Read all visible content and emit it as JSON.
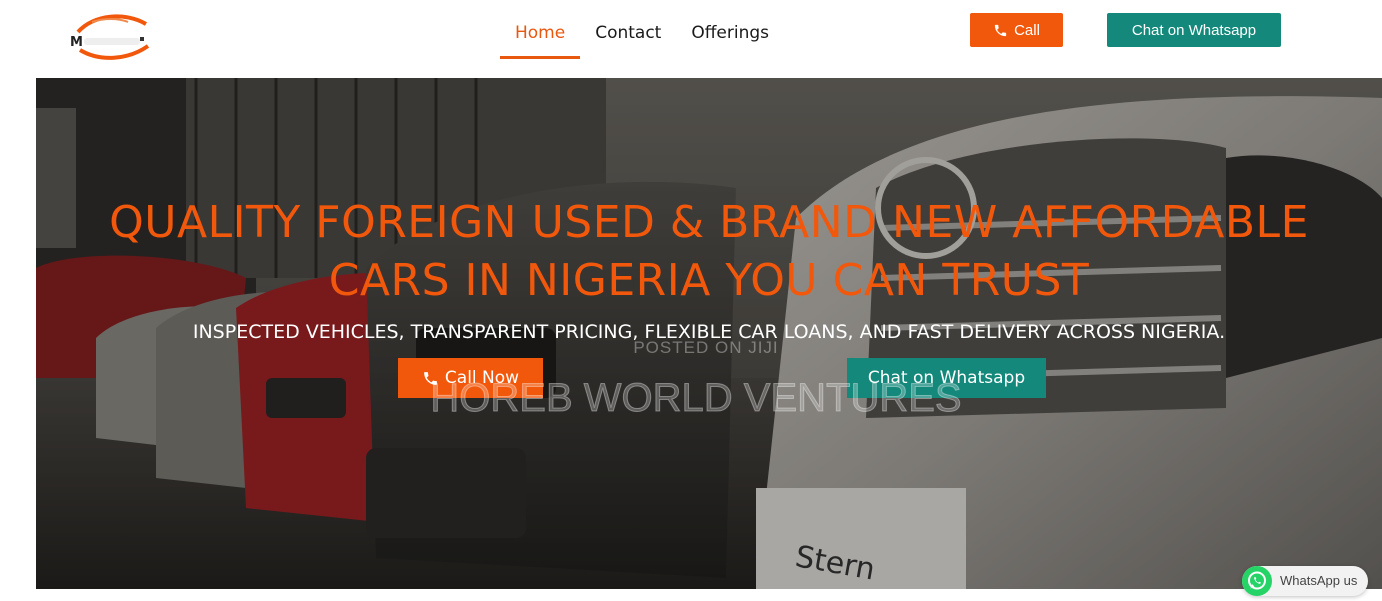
{
  "header": {
    "logo_text": "M",
    "nav": [
      {
        "label": "Home",
        "active": true
      },
      {
        "label": "Contact",
        "active": false
      },
      {
        "label": "Offerings",
        "active": false
      }
    ],
    "call_label": "Call",
    "whatsapp_label": "Chat on Whatsapp"
  },
  "hero": {
    "title_line1": "QUALITY FOREIGN USED & BRAND NEW AFFORDABLE",
    "title_line2": "CARS IN NIGERIA YOU CAN TRUST",
    "subtitle": "INSPECTED VEHICLES, TRANSPARENT PRICING, FLEXIBLE CAR LOANS, AND FAST DELIVERY ACROSS NIGERIA.",
    "call_now_label": "Call Now",
    "whatsapp_label": "Chat on Whatsapp",
    "plate_text": "Stern"
  },
  "watermark": {
    "small": "POSTED ON JIJI",
    "big": "HOREB WORLD VENTURES"
  },
  "whatsapp_float": {
    "label": "WhatsApp us"
  },
  "colors": {
    "accent": "#f2580c",
    "whatsapp": "#14897b",
    "nav_active": "#e9580f"
  },
  "icons": [
    "phone-icon",
    "whatsapp-icon",
    "logo-car-icon"
  ]
}
